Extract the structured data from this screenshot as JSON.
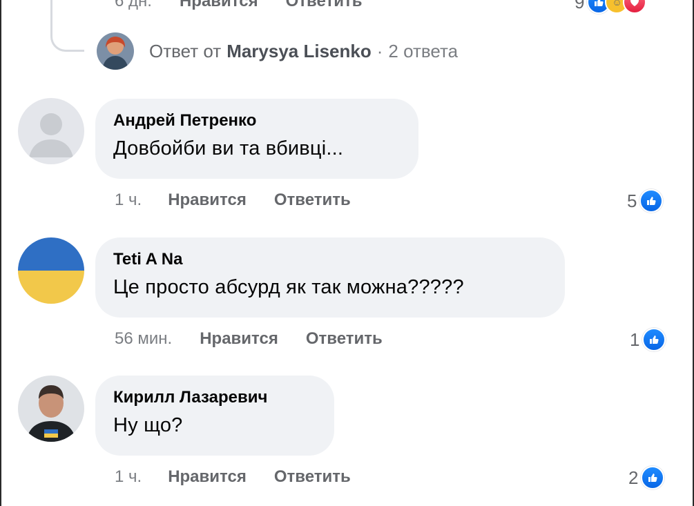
{
  "top_meta": {
    "time": "6 дн.",
    "like": "Нравится",
    "reply": "Ответить",
    "count": "9"
  },
  "reply_summary": {
    "prefix": "Ответ от",
    "name": "Marysya Lisenko",
    "separator": "·",
    "replies": "2 ответа"
  },
  "comments": [
    {
      "author": "Андрей Петренко",
      "text": "Довбойби ви та вбивці...",
      "time": "1 ч.",
      "like": "Нравится",
      "reply": "Ответить",
      "likes": "5"
    },
    {
      "author": "Teti A Na",
      "text": "Це просто абсурд як так можна?????",
      "time": "56 мин.",
      "like": "Нравится",
      "reply": "Ответить",
      "likes": "1"
    },
    {
      "author": "Кирилл Лазаревич",
      "text": "Ну що?",
      "time": "1 ч.",
      "like": "Нравится",
      "reply": "Ответить",
      "likes": "2"
    }
  ],
  "colors": {
    "bubble": "#f0f2f5",
    "like_blue": "#0866e6",
    "love_red": "#e41e3f",
    "meta_gray": "#65676b",
    "ua_blue": "#2f6fc4",
    "ua_yellow": "#f2c84a"
  },
  "icons": {
    "like": "thumbs-up-icon",
    "love": "heart-icon",
    "care": "care-emoji-icon"
  }
}
